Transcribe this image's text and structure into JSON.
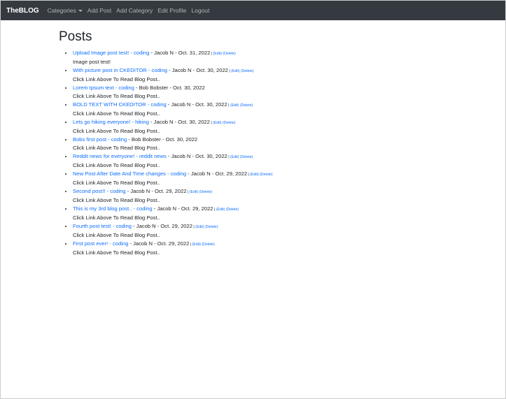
{
  "navbar": {
    "brand": "TheBLOG",
    "items": [
      {
        "label": "Categories",
        "dropdown": true
      },
      {
        "label": "Add Post"
      },
      {
        "label": "Add Category"
      },
      {
        "label": "Edit Profile"
      },
      {
        "label": "Logout"
      }
    ]
  },
  "page": {
    "title": "Posts"
  },
  "posts": [
    {
      "title": "Upload Image post test!",
      "category": "coding",
      "author": "Jacob N",
      "date": "Oct. 31, 2022",
      "editable": true,
      "body": "Image post test!"
    },
    {
      "title": "With picture post in CKEDITOR",
      "category": "coding",
      "author": "Jacob N",
      "date": "Oct. 30, 2022",
      "editable": true,
      "body": "Click Link Above To Read Blog Post.."
    },
    {
      "title": "Lorem Ipsum text",
      "category": "coding",
      "author": "Bob Bobster",
      "date": "Oct. 30, 2022",
      "editable": false,
      "body": "Click Link Above To Read Blog Post.."
    },
    {
      "title": "BOLD TEXT WITH CKEDITOR",
      "category": "coding",
      "author": "Jacob N",
      "date": "Oct. 30, 2022",
      "editable": true,
      "body": "Click Link Above To Read Blog Post.."
    },
    {
      "title": "Lets go hiking everyone!",
      "category": "hiking",
      "author": "Jacob N",
      "date": "Oct. 30, 2022",
      "editable": true,
      "body": "Click Link Above To Read Blog Post.."
    },
    {
      "title": "Bobs first post",
      "category": "coding",
      "author": "Bob Bobster",
      "date": "Oct. 30, 2022",
      "editable": false,
      "body": "Click Link Above To Read Blog Post.."
    },
    {
      "title": "Reddit news for everyone!",
      "category": "reddit news",
      "author": "Jacob N",
      "date": "Oct. 30, 2022",
      "editable": true,
      "body": "Click Link Above To Read Blog Post.."
    },
    {
      "title": "New Post After Date And Time changes",
      "category": "coding",
      "author": "Jacob N",
      "date": "Oct. 29, 2022",
      "editable": true,
      "body": "Click Link Above To Read Blog Post.."
    },
    {
      "title": "Second post!!",
      "category": "coding",
      "author": "Jacob N",
      "date": "Oct. 29, 2022",
      "editable": true,
      "body": "Click Link Above To Read Blog Post.."
    },
    {
      "title": "This is my 3rd blog post..",
      "category": "coding",
      "author": "Jacob N",
      "date": "Oct. 29, 2022",
      "editable": true,
      "body": "Click Link Above To Read Blog Post.."
    },
    {
      "title": "Fourth post test!",
      "category": "coding",
      "author": "Jacob N",
      "date": "Oct. 29, 2022",
      "editable": true,
      "body": "Click Link Above To Read Blog Post.."
    },
    {
      "title": "First post ever!",
      "category": "coding",
      "author": "Jacob N",
      "date": "Oct. 29, 2022",
      "editable": true,
      "body": "Click Link Above To Read Blog Post.."
    }
  ],
  "labels": {
    "edit": "Edit",
    "delete": "Delete"
  }
}
